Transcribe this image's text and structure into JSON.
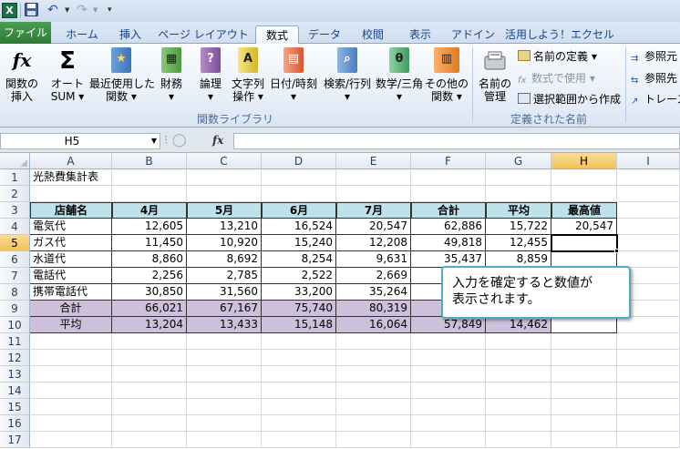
{
  "qat": {
    "app_icon": "X",
    "save_icon": "save-icon",
    "undo_icon": "undo-icon",
    "redo_icon": "redo-icon"
  },
  "tabs": [
    {
      "label": "ファイル"
    },
    {
      "label": "ホーム"
    },
    {
      "label": "挿入"
    },
    {
      "label": "ページ レイアウト"
    },
    {
      "label": "数式"
    },
    {
      "label": "データ"
    },
    {
      "label": "校閲"
    },
    {
      "label": "表示"
    },
    {
      "label": "アドイン"
    },
    {
      "label": "活用しよう！エクセル"
    }
  ],
  "ribbon": {
    "insert_function": {
      "line1": "関数の",
      "line2": "挿入"
    },
    "autosum": {
      "line1": "オート",
      "line2": "SUM ▾"
    },
    "recent": {
      "line1": "最近使用した",
      "line2": "関数 ▾"
    },
    "financial": {
      "line1": "財務",
      "line2": "▾"
    },
    "logical": {
      "line1": "論理",
      "line2": "▾"
    },
    "text": {
      "line1": "文字列",
      "line2": "操作 ▾"
    },
    "datetime": {
      "line1": "日付/時刻",
      "line2": "▾"
    },
    "lookup": {
      "line1": "検索/行列",
      "line2": "▾"
    },
    "math": {
      "line1": "数学/三角",
      "line2": "▾"
    },
    "more": {
      "line1": "その他の",
      "line2": "関数 ▾"
    },
    "library_label": "関数ライブラリ",
    "name_manager": {
      "line1": "名前の",
      "line2": "管理"
    },
    "define_name": "名前の定義 ▾",
    "use_in_formula": "数式で使用 ▾",
    "create_from_selection": "選択範囲から作成",
    "defined_names_label": "定義された名前",
    "trace_precedents": "参照元",
    "trace_dependents": "参照先",
    "remove_arrows": "トレース"
  },
  "formula_bar": {
    "name_box": "H5",
    "fx": "fx",
    "formula": ""
  },
  "grid": {
    "columns": [
      "A",
      "B",
      "C",
      "D",
      "E",
      "F",
      "G",
      "H",
      "I"
    ],
    "rows": [
      "1",
      "2",
      "3",
      "4",
      "5",
      "6",
      "7",
      "8",
      "9",
      "10",
      "11",
      "12",
      "13",
      "14",
      "15",
      "16",
      "17"
    ],
    "title": "光熱費集計表",
    "headers": [
      "店舗名",
      "4月",
      "5月",
      "6月",
      "7月",
      "合計",
      "平均",
      "最高値"
    ],
    "data": [
      [
        "電気代",
        "12,605",
        "13,210",
        "16,524",
        "20,547",
        "62,886",
        "15,722",
        "20,547"
      ],
      [
        "ガス代",
        "11,450",
        "10,920",
        "15,240",
        "12,208",
        "49,818",
        "12,455",
        ""
      ],
      [
        "水道代",
        "8,860",
        "8,692",
        "8,254",
        "9,631",
        "35,437",
        "8,859",
        ""
      ],
      [
        "電話代",
        "2,256",
        "2,785",
        "2,522",
        "2,669",
        "",
        "",
        ""
      ],
      [
        "携帯電話代",
        "30,850",
        "31,560",
        "33,200",
        "35,264",
        "",
        "",
        ""
      ]
    ],
    "totals": [
      [
        "合計",
        "66,021",
        "67,167",
        "75,740",
        "80,319",
        "",
        "",
        ""
      ],
      [
        "平均",
        "13,204",
        "13,433",
        "15,148",
        "16,064",
        "57,849",
        "14,462",
        ""
      ]
    ]
  },
  "callout": {
    "line1": "入力を確定すると数値が",
    "line2": "表示されます。"
  }
}
